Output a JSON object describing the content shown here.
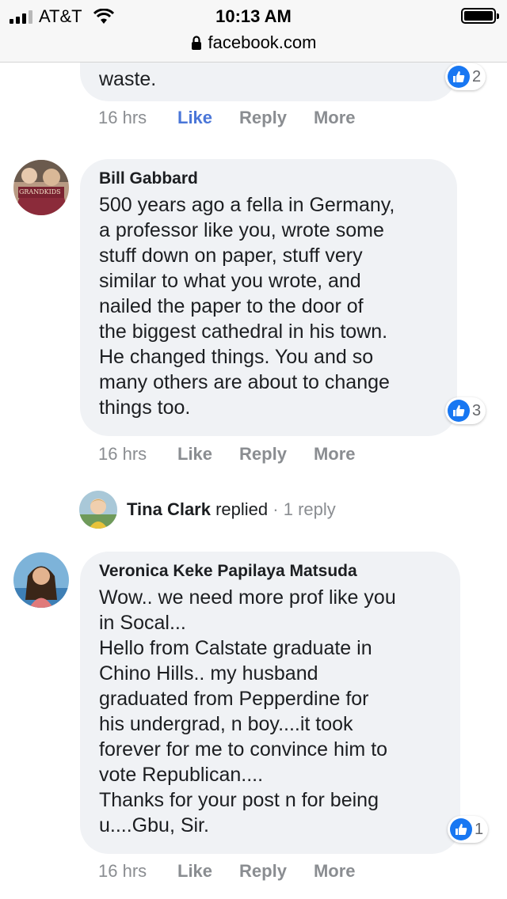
{
  "status_bar": {
    "carrier": "AT&T",
    "time": "10:13 AM"
  },
  "browser": {
    "url": "facebook.com"
  },
  "comments": [
    {
      "author": "",
      "text": "waste.",
      "reactions": "2",
      "time": "16 hrs",
      "like": "Like",
      "reply": "Reply",
      "more": "More",
      "liked": true
    },
    {
      "author": "Bill Gabbard",
      "avatar_caption": "GRANDKIDS",
      "text": "500 years ago a fella in Germany,\na professor like you, wrote some\nstuff down on paper, stuff very\nsimilar to what you wrote, and\nnailed the paper to the door of\nthe biggest cathedral in his town.\nHe changed things. You and so\nmany others are about to change\nthings too.",
      "reactions": "3",
      "time": "16 hrs",
      "like": "Like",
      "reply": "Reply",
      "more": "More"
    },
    {
      "author": "Veronica Keke Papilaya Matsuda",
      "text": "Wow.. we need more prof like you\nin Socal...\nHello from Calstate graduate in\nChino Hills.. my husband\ngraduated from Pepperdine for\nhis undergrad, n boy....it took\nforever for me to convince him to\nvote Republican....\nThanks for your post n for being\nu....Gbu, Sir.",
      "reactions": "1",
      "time": "16 hrs",
      "like": "Like",
      "reply": "Reply",
      "more": "More"
    }
  ],
  "reply_summary": {
    "name": "Tina Clark",
    "verb": "replied",
    "separator": "·",
    "count": "1 reply"
  },
  "colors": {
    "bubble": "#f0f2f5",
    "like_blue": "#1877f2",
    "action_gray": "#8a8d91",
    "active_like": "#4a76d8"
  }
}
